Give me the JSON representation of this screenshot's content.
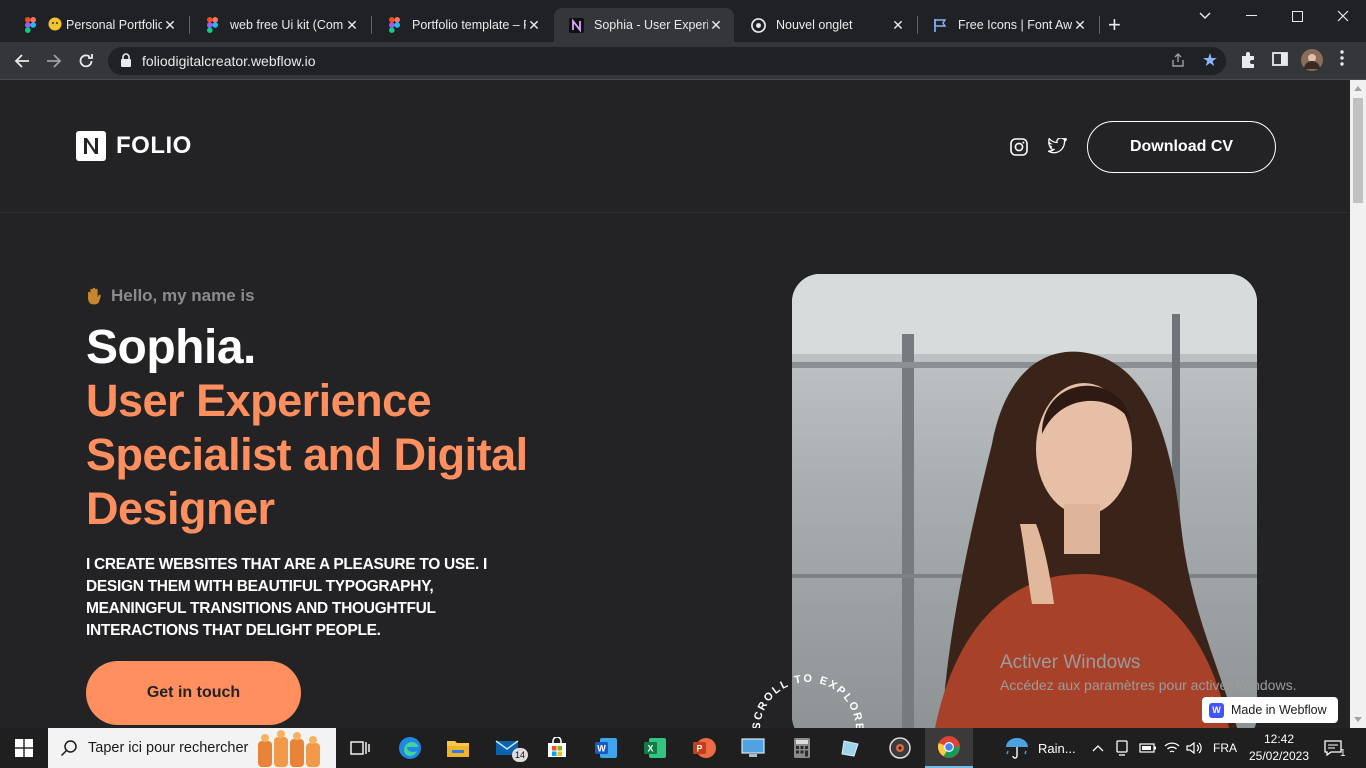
{
  "browser": {
    "tabs": [
      {
        "title": "Personal Portfolio",
        "icon": "figma-icon"
      },
      {
        "title": "web free Ui kit (Comm",
        "icon": "figma-icon"
      },
      {
        "title": "Portfolio template – Fi",
        "icon": "figma-icon"
      },
      {
        "title": "Sophia - User Experien",
        "icon": "webflow-n-icon",
        "active": true
      },
      {
        "title": "Nouvel onglet",
        "icon": "chrome-icon"
      },
      {
        "title": "Free Icons | Font Awes",
        "icon": "flag-icon"
      }
    ],
    "url": "foliodigitalcreator.webflow.io"
  },
  "site": {
    "logo_text": "FOLIO",
    "download_cv": "Download CV",
    "hello": "Hello, my name is",
    "name": "Sophia.",
    "role": "User Experience Specialist and Digital Designer",
    "bio": "I CREATE WEBSITES THAT ARE A PLEASURE TO USE. I DESIGN THEM WITH BEAUTIFUL TYPOGRAPHY, MEANINGFUL TRANSITIONS AND THOUGHTFUL INTERACTIONS THAT DELIGHT PEOPLE.",
    "cta": "Get in touch",
    "scroll_badge": "SCROLL TO EXPLORE",
    "accent_color": "#ff8f5e"
  },
  "overlay": {
    "activate_title": "Activer Windows",
    "activate_sub": "Accédez aux paramètres pour activer Windows.",
    "webflow_badge": "Made in Webflow"
  },
  "taskbar": {
    "search_placeholder": "Taper ici pour rechercher",
    "mail_badge": "14",
    "weather": "Rain...",
    "language": "FRA",
    "time": "12:42",
    "date": "25/02/2023",
    "notif_count": "1"
  }
}
